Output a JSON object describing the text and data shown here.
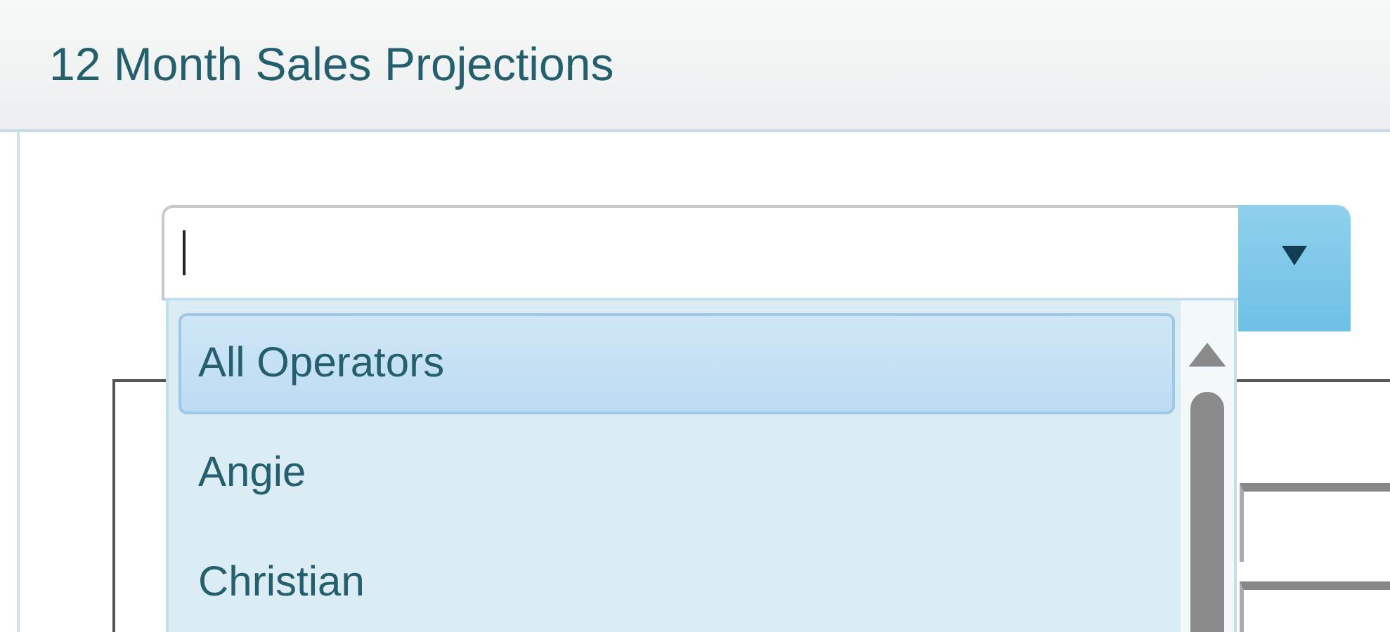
{
  "window": {
    "title": "12 Month Sales Projections"
  },
  "operator_combobox": {
    "expanded": true,
    "options": [
      {
        "label": "All Operators",
        "selected": true
      },
      {
        "label": "Angie",
        "selected": false
      },
      {
        "label": "Christian",
        "selected": false
      }
    ]
  }
}
